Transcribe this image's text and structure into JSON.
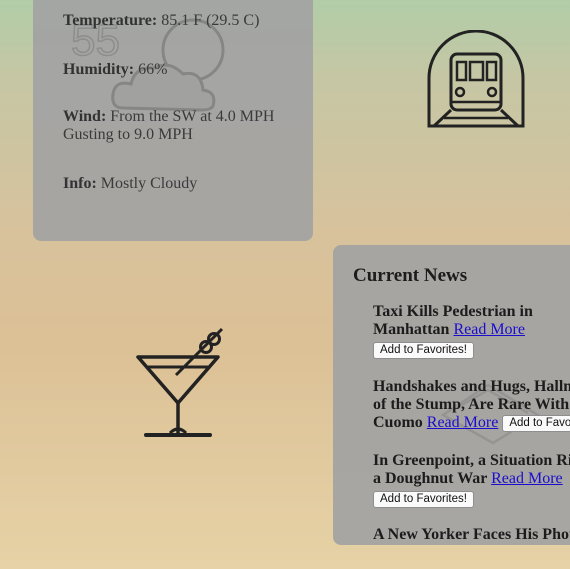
{
  "weather": {
    "bg_number": "55",
    "rows": [
      {
        "label": "Temperature:",
        "value": " 85.1 F (29.5 C)"
      },
      {
        "label": "Humidity:",
        "value": " 66%"
      },
      {
        "label": "Wind:",
        "value": " From the SW at 4.0 MPH",
        "value2": "Gusting to 9.0 MPH"
      },
      {
        "label": "Info:",
        "value": " Mostly Cloudy"
      }
    ]
  },
  "icons": {
    "subway": "subway-train-icon",
    "cocktail": "martini-glass-icon",
    "weather": "partly-cloudy-icon"
  },
  "news": {
    "heading": "Current News",
    "read_more": "Read More",
    "fav_label": "Add to Favorites!",
    "items": [
      {
        "line1": "Taxi Kills Pedestrian in",
        "line2": "Manhattan"
      },
      {
        "line1": "Handshakes and Hugs, Hallmarks",
        "line2": "of the Stump, Are Rare With",
        "line3": "Cuomo"
      },
      {
        "line1": "In Greenpoint, a Situation Rises",
        "line2": "a Doughnut War"
      },
      {
        "line1": "A New Yorker Faces His Photo"
      }
    ]
  }
}
